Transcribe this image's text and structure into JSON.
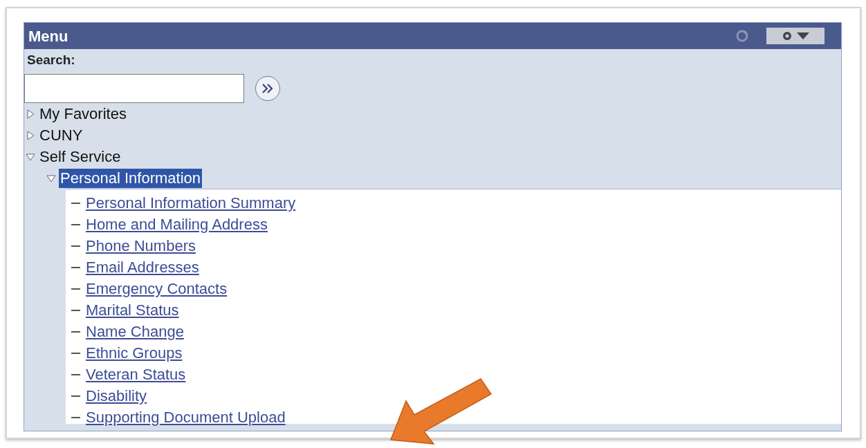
{
  "menu": {
    "title": "Menu",
    "search": {
      "label": "Search:"
    },
    "tree": [
      {
        "label": "My Favorites",
        "expanded": false,
        "selected": false
      },
      {
        "label": "CUNY",
        "expanded": false,
        "selected": false
      },
      {
        "label": "Self Service",
        "expanded": true,
        "selected": false,
        "children": [
          {
            "label": "Personal Information",
            "expanded": true,
            "selected": true,
            "children": [
              {
                "label": "Personal Information Summary",
                "kind": "link"
              },
              {
                "label": "Home and Mailing Address",
                "kind": "link"
              },
              {
                "label": "Phone Numbers",
                "kind": "link"
              },
              {
                "label": "Email Addresses",
                "kind": "link"
              },
              {
                "label": "Emergency Contacts",
                "kind": "link"
              },
              {
                "label": "Marital Status",
                "kind": "link"
              },
              {
                "label": "Name Change",
                "kind": "link"
              },
              {
                "label": "Ethnic Groups",
                "kind": "link"
              },
              {
                "label": "Veteran Status",
                "kind": "link"
              },
              {
                "label": "Disability",
                "kind": "link"
              },
              {
                "label": "Supporting Document Upload",
                "kind": "link"
              }
            ]
          }
        ]
      }
    ]
  }
}
